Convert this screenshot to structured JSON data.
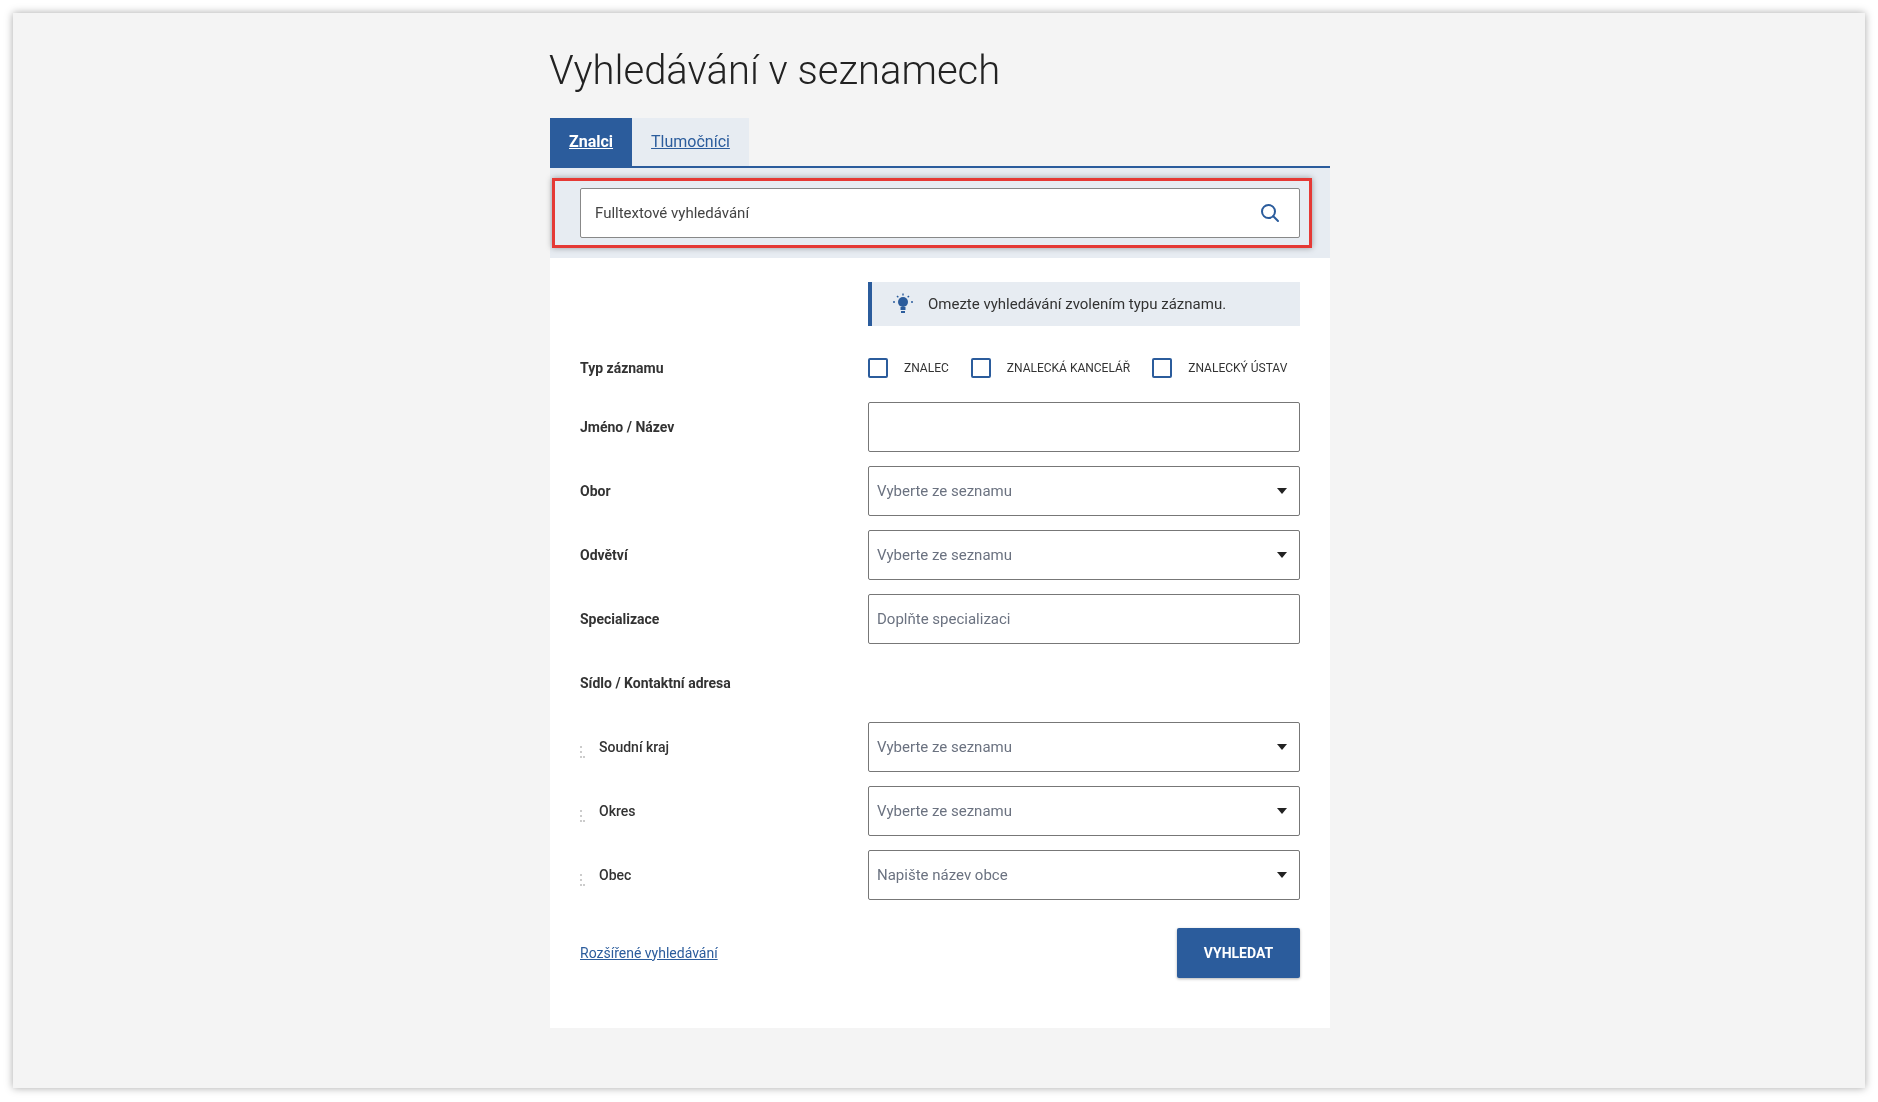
{
  "title": "Vyhledávání v seznamech",
  "tabs": [
    {
      "label": "Znalci",
      "selected": true
    },
    {
      "label": "Tlumočníci",
      "selected": false
    }
  ],
  "search": {
    "placeholder": "Fulltextové vyhledávání",
    "highlighted": true
  },
  "hint": "Omezte vyhledávání zvolením typu záznamu.",
  "record_type": {
    "label": "Typ záznamu",
    "options": [
      {
        "label": "ZNALEC",
        "checked": false
      },
      {
        "label": "ZNALECKÁ KANCELÁŘ",
        "checked": false
      },
      {
        "label": "ZNALECKÝ ÚSTAV",
        "checked": false
      }
    ]
  },
  "fields": [
    {
      "kind": "text",
      "label": "Jméno / Název"
    },
    {
      "kind": "select",
      "label": "Obor",
      "placeholder": "Vyberte ze seznamu"
    },
    {
      "kind": "select",
      "label": "Odvětví",
      "placeholder": "Vyberte ze seznamu"
    },
    {
      "kind": "text",
      "label": "Specializace",
      "placeholder": "Doplňte specializaci"
    },
    {
      "kind": "section",
      "label": "Sídlo / Kontaktní adresa",
      "children": [
        {
          "kind": "select",
          "label": "Soudní kraj",
          "placeholder": "Vyberte ze seznamu"
        },
        {
          "kind": "select",
          "label": "Okres",
          "placeholder": "Vyberte ze seznamu"
        },
        {
          "kind": "select",
          "label": "Obec",
          "placeholder": "Napište název obce"
        }
      ]
    }
  ],
  "advanced_link": "Rozšířené vyhledávání",
  "submit": "VYHLEDAT"
}
